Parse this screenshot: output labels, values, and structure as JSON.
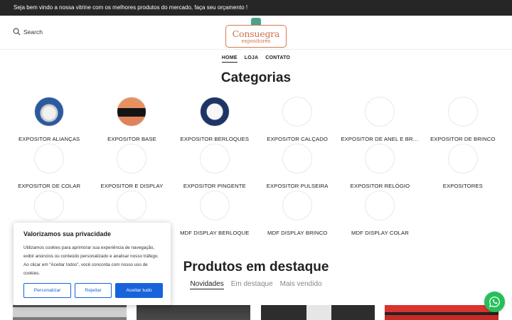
{
  "topbar": {
    "message": "Seja bem vindo a nossa vitrine com os melhores produtos do mercado, faça seu orçamento !"
  },
  "header": {
    "search_label": "Search",
    "logo_title": "Consuegra",
    "logo_subtitle": "expositores",
    "logo_colors": {
      "border": "#d57a53",
      "gem": "#4da18b"
    }
  },
  "nav": [
    "HOME",
    "LOJA",
    "CONTATO"
  ],
  "categories": {
    "title": "Categorias",
    "items": [
      {
        "label": "EXPOSITOR ALIANÇAS",
        "image": "img-alliance"
      },
      {
        "label": "EXPOSITOR BASE",
        "image": "img-base"
      },
      {
        "label": "EXPOSITOR BERLOQUES",
        "image": "img-berloques"
      },
      {
        "label": "EXPOSITOR CALÇADO",
        "image": ""
      },
      {
        "label": "EXPOSITOR DE ANEL E BRINCO",
        "image": ""
      },
      {
        "label": "EXPOSITOR DE BRINCO",
        "image": ""
      },
      {
        "label": "EXPOSITOR DE COLAR",
        "image": ""
      },
      {
        "label": "EXPOSITOR E DISPLAY",
        "image": ""
      },
      {
        "label": "EXPOSITOR PINGENTE",
        "image": ""
      },
      {
        "label": "EXPOSITOR PULSEIRA",
        "image": ""
      },
      {
        "label": "EXPOSITOR RELÓGIO",
        "image": ""
      },
      {
        "label": "EXPOSITORES",
        "image": ""
      },
      {
        "label": "",
        "image": ""
      },
      {
        "label": "",
        "image": ""
      },
      {
        "label": "MDF DISPLAY BERLOQUE",
        "image": ""
      },
      {
        "label": "MDF DISPLAY BRINCO",
        "image": ""
      },
      {
        "label": "MDF DISPLAY COLAR",
        "image": ""
      }
    ]
  },
  "products": {
    "title": "Produtos em destaque",
    "tabs": [
      "Novidades",
      "Em destaque",
      "Mais vendido"
    ]
  },
  "cookie": {
    "title": "Valorizamos sua privacidade",
    "text": "Utilizamos cookies para aprimorar sua experiência de navegação, exibir anúncios ou conteúdo personalizado e analisar nosso tráfego. Ao clicar em “Aceitar todos”, você concorda com nosso uso de cookies.",
    "customize_label": "Personalizar",
    "reject_label": "Rejeitar",
    "accept_label": "Aceitar tudo",
    "accent_color": "#1863dc"
  },
  "whatsapp": {
    "icon": "whatsapp-icon",
    "color": "#25c05a"
  }
}
